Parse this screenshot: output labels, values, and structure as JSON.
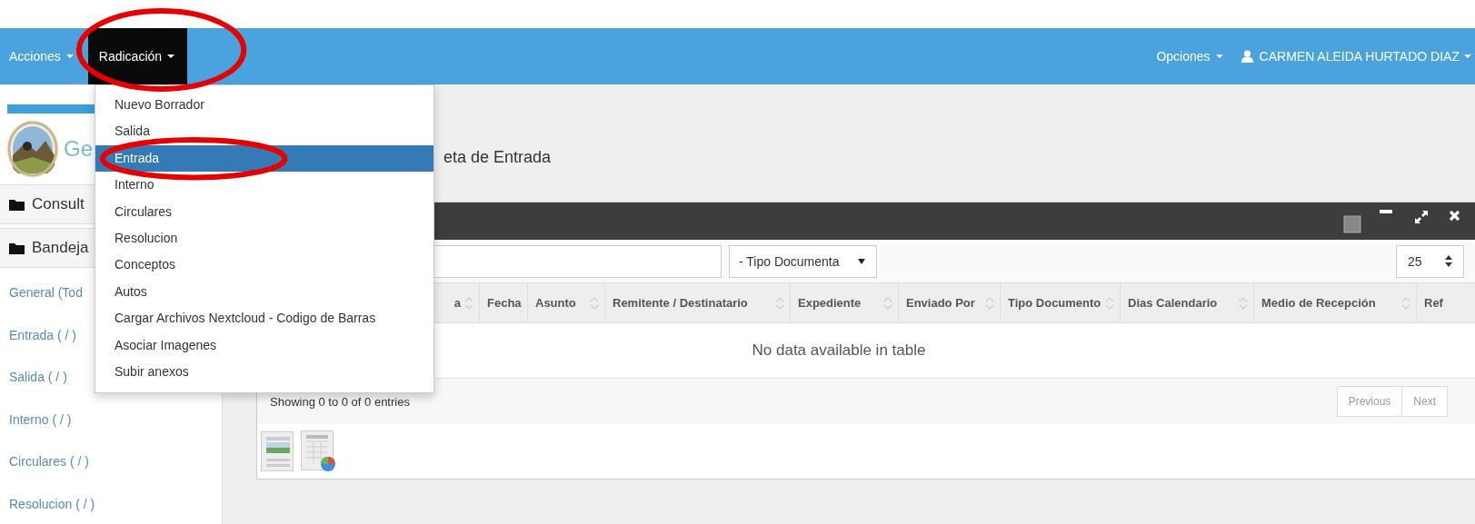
{
  "nav": {
    "menus": [
      {
        "label": "Acciones",
        "selected": false,
        "highlighted": false
      },
      {
        "label": "Radicación",
        "selected": true,
        "highlighted": true
      }
    ],
    "right_menus": [
      {
        "label": "Opciones",
        "kind": "plain"
      },
      {
        "label": "CARMEN ALEIDA HURTADO DIAZ",
        "kind": "user"
      }
    ]
  },
  "dropdown": {
    "items": [
      {
        "label": "Nuevo Borrador",
        "selected": false,
        "highlighted": false
      },
      {
        "label": "Salida",
        "selected": false,
        "highlighted": false
      },
      {
        "label": "Entrada",
        "selected": true,
        "highlighted": true
      },
      {
        "label": "Interno",
        "selected": false,
        "highlighted": false
      },
      {
        "label": "Circulares",
        "selected": false,
        "highlighted": false
      },
      {
        "label": "Resolucion",
        "selected": false,
        "highlighted": false
      },
      {
        "label": "Conceptos",
        "selected": false,
        "highlighted": false
      },
      {
        "label": "Autos",
        "selected": false,
        "highlighted": false
      },
      {
        "label": "Cargar Archivos Nextcloud - Codigo de Barras",
        "selected": false,
        "highlighted": false
      },
      {
        "label": "Asociar Imagenes",
        "selected": false,
        "highlighted": false
      },
      {
        "label": "Subir anexos",
        "selected": false,
        "highlighted": false
      }
    ]
  },
  "sidebar": {
    "brand": "Ge",
    "sections": [
      "Consult",
      "Bandeja"
    ],
    "items": [
      "General (Tod",
      "Entrada ( / )",
      "Salida ( / )",
      "Interno ( / )",
      "Circulares ( / )",
      "Resolucion ( / )"
    ]
  },
  "page_title": "eta de Entrada",
  "panel": {
    "filter_select": "- Tipo Documenta",
    "page_size": "25",
    "columns": [
      "a",
      "Fecha",
      "Asunto",
      "Remitente / Destinatario",
      "Expediente",
      "Enviado Por",
      "Tipo Documento",
      "Dias Calendario",
      "Medio de Recepción",
      "Ref"
    ],
    "empty_message": "No data available in table",
    "info": "Showing 0 to 0 of 0 entries",
    "pagination": [
      {
        "label": "Previous",
        "disabled": true
      },
      {
        "label": "Next",
        "disabled": true
      }
    ]
  }
}
